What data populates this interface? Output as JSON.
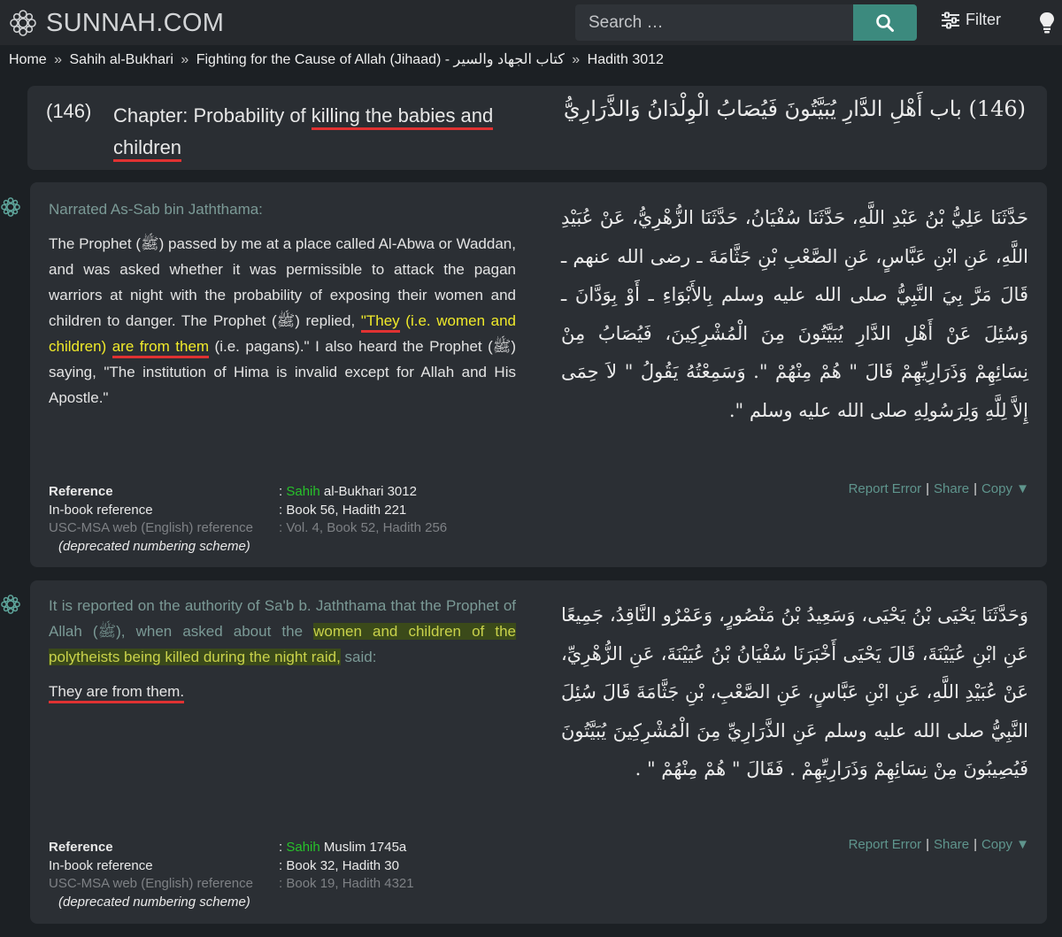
{
  "brand": {
    "name": "SUNNAH.COM"
  },
  "search": {
    "placeholder": "Search …"
  },
  "toolbar": {
    "filter_label": "Filter"
  },
  "breadcrumb": {
    "separator": "»",
    "items": [
      "Home",
      "Sahih al-Bukhari",
      "Fighting for the Cause of Allah (Jihaad) - كتاب الجهاد والسير",
      "Hadith 3012"
    ]
  },
  "chapter": {
    "number": "(146)",
    "title_prefix": "Chapter: Probability of ",
    "title_highlight_1": "killing the babies and",
    "title_highlight_2": "children",
    "arabic_number": "(146)",
    "arabic_title": "باب أَهْلِ الدَّارِ يُبَيَّتُونَ فَيُصَابُ الْوِلْدَانُ وَالذَّرَارِيُّ"
  },
  "hadiths": [
    {
      "narrator": "Narrated As-Sab bin Jaththama:",
      "text_1": "The Prophet (ﷺ) passed by me at a place called Al-Abwa or Waddan, and was asked whether it was permissible to attack the pagan warriors at night with the probability of exposing their women and children to danger. The Prophet (ﷺ) replied, ",
      "text_hl_1": "\"They",
      "text_hl_2": "(i.e. women and children) ",
      "text_hl_3": "are from them",
      "text_2": " (i.e. pagans).\" I also heard the Prophet (ﷺ) saying, \"The institution of Hima is invalid except for Allah and His Apostle.\"",
      "arabic": "حَدَّثَنَا عَلِيُّ بْنُ عَبْدِ اللَّهِ، حَدَّثَنَا سُفْيَانُ، حَدَّثَنَا الزُّهْرِيُّ، عَنْ عُبَيْدِ اللَّهِ، عَنِ ابْنِ عَبَّاسٍ، عَنِ الصَّعْبِ بْنِ جَثَّامَةَ ـ رضى الله عنهم ـ قَالَ مَرَّ بِيَ النَّبِيُّ صلى الله عليه وسلم بِالأَبْوَاءِ ـ أَوْ بِوَدَّانَ ـ وَسُئِلَ عَنْ أَهْلِ الدَّارِ يُبَيَّتُونَ مِنَ الْمُشْرِكِينَ، فَيُصَابُ مِنْ نِسَائِهِمْ وَذَرَارِيِّهِمْ قَالَ \" هُمْ مِنْهُمْ \". وَسَمِعْتُهُ يَقُولُ \" لاَ حِمَى إِلاَّ لِلَّهِ وَلِرَسُولِهِ صلى الله عليه وسلم \".",
      "ref_label": "Reference",
      "ref_grade": "Sahih",
      "ref_value": " al-Bukhari 3012",
      "inbook_label": "In-book reference",
      "inbook_value": "Book 56, Hadith 221",
      "usc_label": "USC-MSA web (English) reference",
      "usc_value": "Vol. 4, Book 52, Hadith 256",
      "deprecated_note": "(deprecated numbering scheme)"
    },
    {
      "narrator_1": "It is reported on the authority of Sa'b b. Jaththama that the Prophet of Allah (ﷺ), when asked about the ",
      "narrator_hl": "women and children of the polytheists being killed during the night raid,",
      "narrator_2": " said:",
      "text": "They are from them.",
      "arabic": "وَحَدَّثَنَا يَحْيَى بْنُ يَحْيَى، وَسَعِيدُ بْنُ مَنْصُورٍ، وَعَمْرٌو النَّاقِدُ، جَمِيعًا عَنِ ابْنِ عُيَيْنَةَ، قَالَ يَحْيَى أَخْبَرَنَا سُفْيَانُ بْنُ عُيَيْنَةَ، عَنِ الزُّهْرِيِّ، عَنْ عُبَيْدِ اللَّهِ، عَنِ ابْنِ عَبَّاسٍ، عَنِ الصَّعْبِ، بْنِ جَثَّامَةَ قَالَ سُئِلَ النَّبِيُّ صلى الله عليه وسلم عَنِ الذَّرَارِيِّ مِنَ الْمُشْرِكِينَ يُبَيَّتُونَ فَيُصِيبُونَ مِنْ نِسَائِهِمْ وَذَرَارِيِّهِمْ . فَقَالَ \" هُمْ مِنْهُمْ \" .",
      "ref_label": "Reference",
      "ref_grade": "Sahih",
      "ref_value": " Muslim 1745a",
      "inbook_label": "In-book reference",
      "inbook_value": "Book 32, Hadith 30",
      "usc_label": "USC-MSA web (English) reference",
      "usc_value": "Book 19, Hadith 4321",
      "deprecated_note": "(deprecated numbering scheme)"
    }
  ],
  "actions": {
    "report": "Report Error",
    "share": "Share",
    "copy": "Copy ▼"
  },
  "colors": {
    "accent": "#3c8a7e",
    "grade": "#27c22a",
    "underline": "#e03232",
    "highlight_text": "#f0ea2a"
  }
}
